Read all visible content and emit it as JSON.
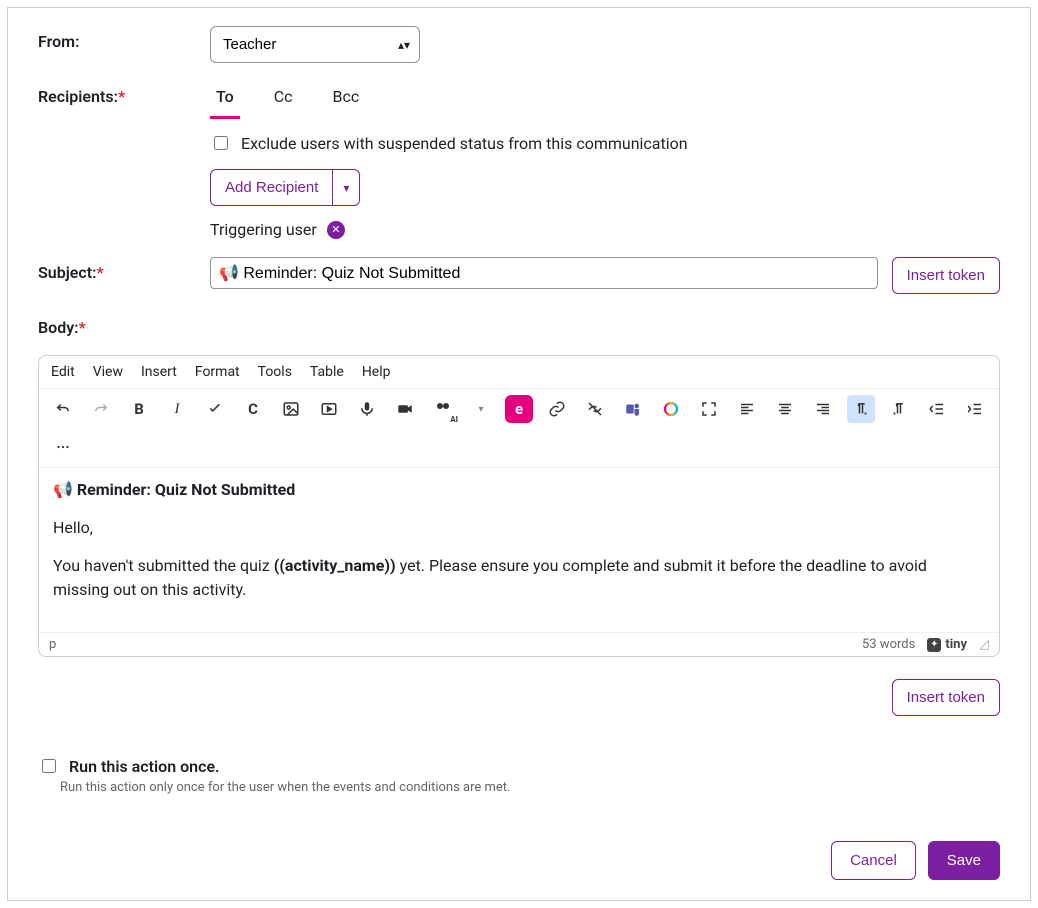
{
  "labels": {
    "from": "From:",
    "recipients": "Recipients:",
    "subject": "Subject:",
    "body": "Body:"
  },
  "from": {
    "selected": "Teacher"
  },
  "tabs": {
    "to": "To",
    "cc": "Cc",
    "bcc": "Bcc"
  },
  "exclude_label": "Exclude users with suspended status from this communication",
  "add_recipient": "Add Recipient",
  "trigger_chip": "Triggering user",
  "subject_value": "📢 Reminder: Quiz Not Submitted",
  "insert_token": "Insert token",
  "editor": {
    "menu": {
      "edit": "Edit",
      "view": "View",
      "insert": "Insert",
      "format": "Format",
      "tools": "Tools",
      "table": "Table",
      "help": "Help"
    },
    "body_heading_prefix": "📢 ",
    "body_heading": "Reminder: Quiz Not Submitted",
    "p1": "Hello,",
    "p2_a": "You haven't submitted the quiz ",
    "p2_token": "((activity_name))",
    "p2_b": " yet. Please ensure you complete and submit it before the deadline to avoid missing out on this activity.",
    "path": "p",
    "wordcount": "53 words",
    "brand": "tiny"
  },
  "run_once": {
    "label": "Run this action once.",
    "help": "Run this action only once for the user when the events and conditions are met."
  },
  "footer": {
    "cancel": "Cancel",
    "save": "Save"
  }
}
